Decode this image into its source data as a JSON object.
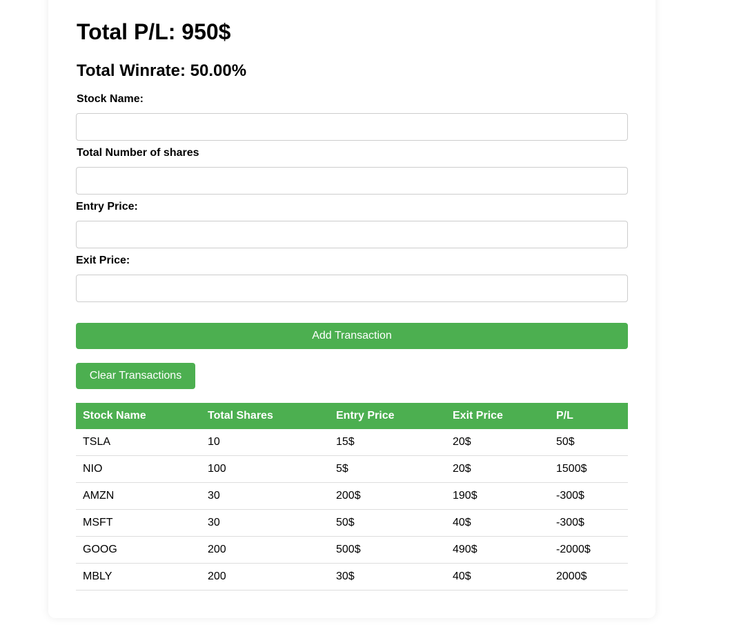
{
  "summary": {
    "total_pl": "Total P/L: 950$",
    "total_winrate": "Total Winrate: 50.00%"
  },
  "form": {
    "stock_name_label": "Stock Name:",
    "stock_name_value": "",
    "shares_label": "Total Number of shares",
    "shares_value": "",
    "entry_price_label": "Entry Price:",
    "entry_price_value": "",
    "exit_price_label": "Exit Price:",
    "exit_price_value": ""
  },
  "buttons": {
    "add": "Add Transaction",
    "clear": "Clear Transactions"
  },
  "table": {
    "headers": [
      "Stock Name",
      "Total Shares",
      "Entry Price",
      "Exit Price",
      "P/L"
    ],
    "rows": [
      [
        "TSLA",
        "10",
        "15$",
        "20$",
        "50$"
      ],
      [
        "NIO",
        "100",
        "5$",
        "20$",
        "1500$"
      ],
      [
        "AMZN",
        "30",
        "200$",
        "190$",
        "-300$"
      ],
      [
        "MSFT",
        "30",
        "50$",
        "40$",
        "-300$"
      ],
      [
        "GOOG",
        "200",
        "500$",
        "490$",
        "-2000$"
      ],
      [
        "MBLY",
        "200",
        "30$",
        "40$",
        "2000$"
      ]
    ]
  },
  "colors": {
    "accent": "#4caf50"
  }
}
